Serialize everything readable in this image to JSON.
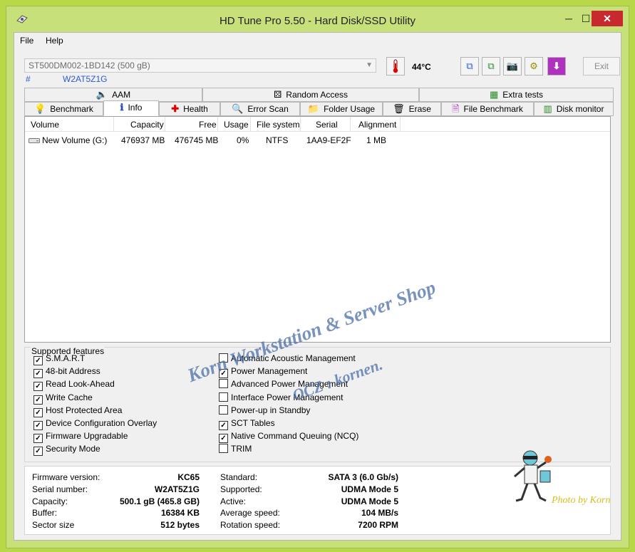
{
  "window": {
    "title": "HD Tune Pro 5.50 - Hard Disk/SSD Utility",
    "minimize": "─",
    "maximize": "☐",
    "close": "✕"
  },
  "menu": {
    "file": "File",
    "help": "Help"
  },
  "drive": {
    "selected": "ST500DM002-1BD142 (500 gB)",
    "hash": "#",
    "serial": "W2AT5Z1G"
  },
  "temperature": "44°C",
  "toolbar": {
    "exit": "Exit"
  },
  "tabs_top": [
    {
      "label": "AAM",
      "icon": "speaker-icon"
    },
    {
      "label": "Random Access",
      "icon": "dice-icon"
    },
    {
      "label": "Extra tests",
      "icon": "calculator-icon"
    }
  ],
  "tabs_bottom": [
    {
      "label": "Benchmark",
      "icon": "bulb-icon"
    },
    {
      "label": "Info",
      "icon": "info-icon"
    },
    {
      "label": "Health",
      "icon": "health-cross-icon"
    },
    {
      "label": "Error Scan",
      "icon": "magnifier-icon"
    },
    {
      "label": "Folder Usage",
      "icon": "folder-icon"
    },
    {
      "label": "Erase",
      "icon": "trash-icon"
    },
    {
      "label": "File Benchmark",
      "icon": "file-bulb-icon"
    },
    {
      "label": "Disk monitor",
      "icon": "bar-chart-icon"
    }
  ],
  "volumes": {
    "headers": [
      "Volume",
      "Capacity",
      "Free",
      "Usage",
      "File system",
      "Serial",
      "Alignment"
    ],
    "rows": [
      [
        "New Volume (G:)",
        "476937 MB",
        "476745 MB",
        "0%",
        "NTFS",
        "1AA9-EF2F",
        "1 MB"
      ]
    ]
  },
  "features": {
    "title": "Supported features",
    "left": [
      {
        "label": "S.M.A.R.T",
        "checked": true
      },
      {
        "label": "48-bit Address",
        "checked": true
      },
      {
        "label": "Read Look-Ahead",
        "checked": true
      },
      {
        "label": "Write Cache",
        "checked": true
      },
      {
        "label": "Host Protected Area",
        "checked": true
      },
      {
        "label": "Device Configuration Overlay",
        "checked": true
      },
      {
        "label": "Firmware Upgradable",
        "checked": true
      },
      {
        "label": "Security Mode",
        "checked": true
      }
    ],
    "right": [
      {
        "label": "Automatic Acoustic Management",
        "checked": false
      },
      {
        "label": "Power Management",
        "checked": true
      },
      {
        "label": "Advanced Power Management",
        "checked": false
      },
      {
        "label": "Interface Power Management",
        "checked": false
      },
      {
        "label": "Power-up in Standby",
        "checked": false
      },
      {
        "label": "SCT Tables",
        "checked": true
      },
      {
        "label": "Native Command Queuing (NCQ)",
        "checked": true
      },
      {
        "label": "TRIM",
        "checked": false
      }
    ]
  },
  "details": {
    "left": [
      {
        "label": "Firmware version:",
        "value": "KC65"
      },
      {
        "label": "Serial number:",
        "value": "W2AT5Z1G"
      },
      {
        "label": "Capacity:",
        "value": "500.1 gB (465.8 GB)"
      },
      {
        "label": "Buffer:",
        "value": "16384 KB"
      },
      {
        "label": "Sector size",
        "value": "512 bytes"
      }
    ],
    "right": [
      {
        "label": "Standard:",
        "value": "SATA 3 (6.0 Gb/s)"
      },
      {
        "label": "Supported:",
        "value": "UDMA Mode 5"
      },
      {
        "label": "Active:",
        "value": "UDMA Mode 5"
      },
      {
        "label": "Average speed:",
        "value": "104 MB/s"
      },
      {
        "label": "Rotation speed:",
        "value": "7200 RPM"
      }
    ]
  },
  "watermark": {
    "line1": "Korn Workstation & Server Shop",
    "line2": "OCZ : kornen.",
    "signature": "Photo by Korn"
  }
}
